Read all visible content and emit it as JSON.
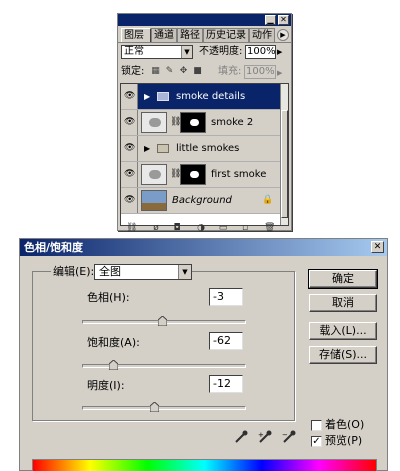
{
  "layers_panel": {
    "tabs": [
      {
        "label": "图层",
        "active": true
      },
      {
        "label": "通道",
        "active": false
      },
      {
        "label": "路径",
        "active": false
      },
      {
        "label": "历史记录",
        "active": false
      },
      {
        "label": "动作",
        "active": false
      }
    ],
    "blend_mode": "正常",
    "opacity_label": "不透明度:",
    "opacity_value": "100%",
    "lock_label": "锁定:",
    "fill_label": "填充:",
    "fill_value": "100%",
    "layers": [
      {
        "name": "smoke details",
        "kind": "group",
        "selected": true,
        "visible": true
      },
      {
        "name": "smoke 2",
        "kind": "layer_with_mask",
        "selected": false,
        "visible": true
      },
      {
        "name": "little smokes",
        "kind": "group",
        "selected": false,
        "visible": true
      },
      {
        "name": "first smoke",
        "kind": "layer_with_mask",
        "selected": false,
        "visible": true
      },
      {
        "name": "Background",
        "kind": "background",
        "selected": false,
        "visible": true,
        "locked": true
      }
    ],
    "icons": {
      "eye": "eye-icon",
      "folder": "folder-icon",
      "chain": "chain-icon",
      "lock": "lock-icon"
    }
  },
  "hue_saturation": {
    "title": "色相/饱和度",
    "edit_label": "编辑(E):",
    "edit_value": "全图",
    "hue_label": "色相(H):",
    "hue_value": "-3",
    "saturation_label": "饱和度(A):",
    "saturation_value": "-62",
    "lightness_label": "明度(I):",
    "lightness_value": "-12",
    "ok_button": "确定",
    "cancel_button": "取消",
    "load_button": "载入(L)...",
    "save_button": "存储(S)...",
    "colorize_label": "着色(O)",
    "colorize_checked": false,
    "preview_label": "预览(P)",
    "preview_checked": true,
    "accent_color": "#0a246a"
  }
}
